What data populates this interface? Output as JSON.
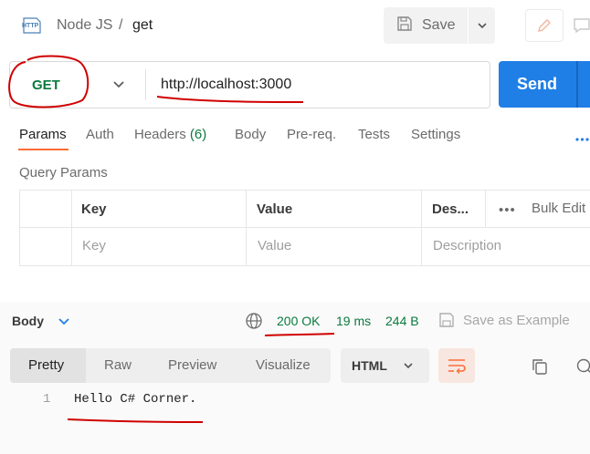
{
  "header": {
    "icon": "http-file-icon",
    "icon_text": "HTTP",
    "breadcrumb_parent": "Node JS",
    "breadcrumb_sep": "/",
    "breadcrumb_current": "get",
    "save_label": "Save"
  },
  "request": {
    "method": "GET",
    "url": "http://localhost:3000",
    "send_label": "Send"
  },
  "request_tabs": [
    {
      "label": "Params",
      "active": true
    },
    {
      "label": "Auth"
    },
    {
      "label": "Headers",
      "count": "(6)"
    },
    {
      "label": "Body"
    },
    {
      "label": "Pre-req."
    },
    {
      "label": "Tests"
    },
    {
      "label": "Settings"
    }
  ],
  "query_params": {
    "title": "Query Params",
    "headers": {
      "key": "Key",
      "value": "Value",
      "description": "Des..."
    },
    "placeholders": {
      "key": "Key",
      "value": "Value",
      "description": "Description"
    },
    "bulk_edit": "Bulk Edit"
  },
  "response": {
    "label": "Body",
    "status": "200 OK",
    "time": "19 ms",
    "size": "244 B",
    "save_as_example": "Save as Example",
    "view_tabs": [
      {
        "label": "Pretty",
        "active": true
      },
      {
        "label": "Raw"
      },
      {
        "label": "Preview"
      },
      {
        "label": "Visualize"
      }
    ],
    "format": "HTML",
    "lines": [
      {
        "num": "1",
        "text": "Hello C# Corner."
      }
    ]
  },
  "colors": {
    "accent": "#ff6c37",
    "send": "#1f7fe6",
    "success": "#0b7a3e",
    "annotation": "#d00000"
  }
}
